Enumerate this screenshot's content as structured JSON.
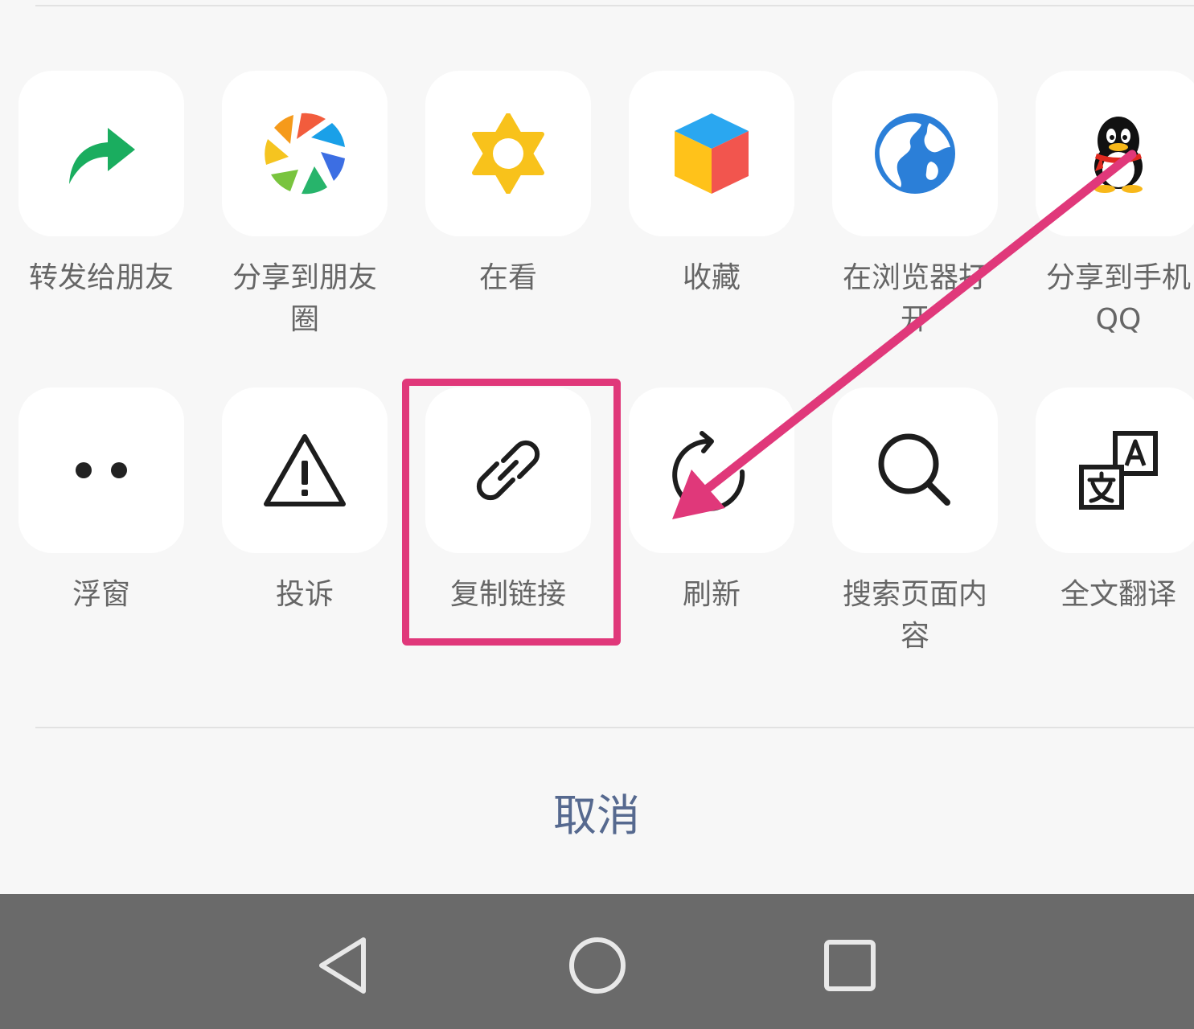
{
  "share_sheet": {
    "row1": [
      {
        "label": "转发给朋友",
        "icon": "forward-icon"
      },
      {
        "label": "分享到朋友圈",
        "icon": "moments-icon"
      },
      {
        "label": "在看",
        "icon": "wow-icon"
      },
      {
        "label": "收藏",
        "icon": "favorite-icon"
      },
      {
        "label": "在浏览器打开",
        "icon": "browser-icon"
      },
      {
        "label": "分享到手机QQ",
        "icon": "qq-icon"
      }
    ],
    "row2": [
      {
        "label": "浮窗",
        "icon": "float-window-icon"
      },
      {
        "label": "投诉",
        "icon": "warning-icon"
      },
      {
        "label": "复制链接",
        "icon": "link-icon"
      },
      {
        "label": "刷新",
        "icon": "refresh-icon"
      },
      {
        "label": "搜索页面内容",
        "icon": "search-icon"
      },
      {
        "label": "全文翻译",
        "icon": "translate-icon"
      }
    ],
    "cancel_label": "取消"
  },
  "colors": {
    "highlight": "#e0387a",
    "cancel_text": "#56698f",
    "forward_green": "#1aad5f",
    "navbar": "#6a6a6a"
  },
  "navbar": {
    "back": "back-icon",
    "home": "home-icon",
    "recent": "recent-apps-icon"
  }
}
